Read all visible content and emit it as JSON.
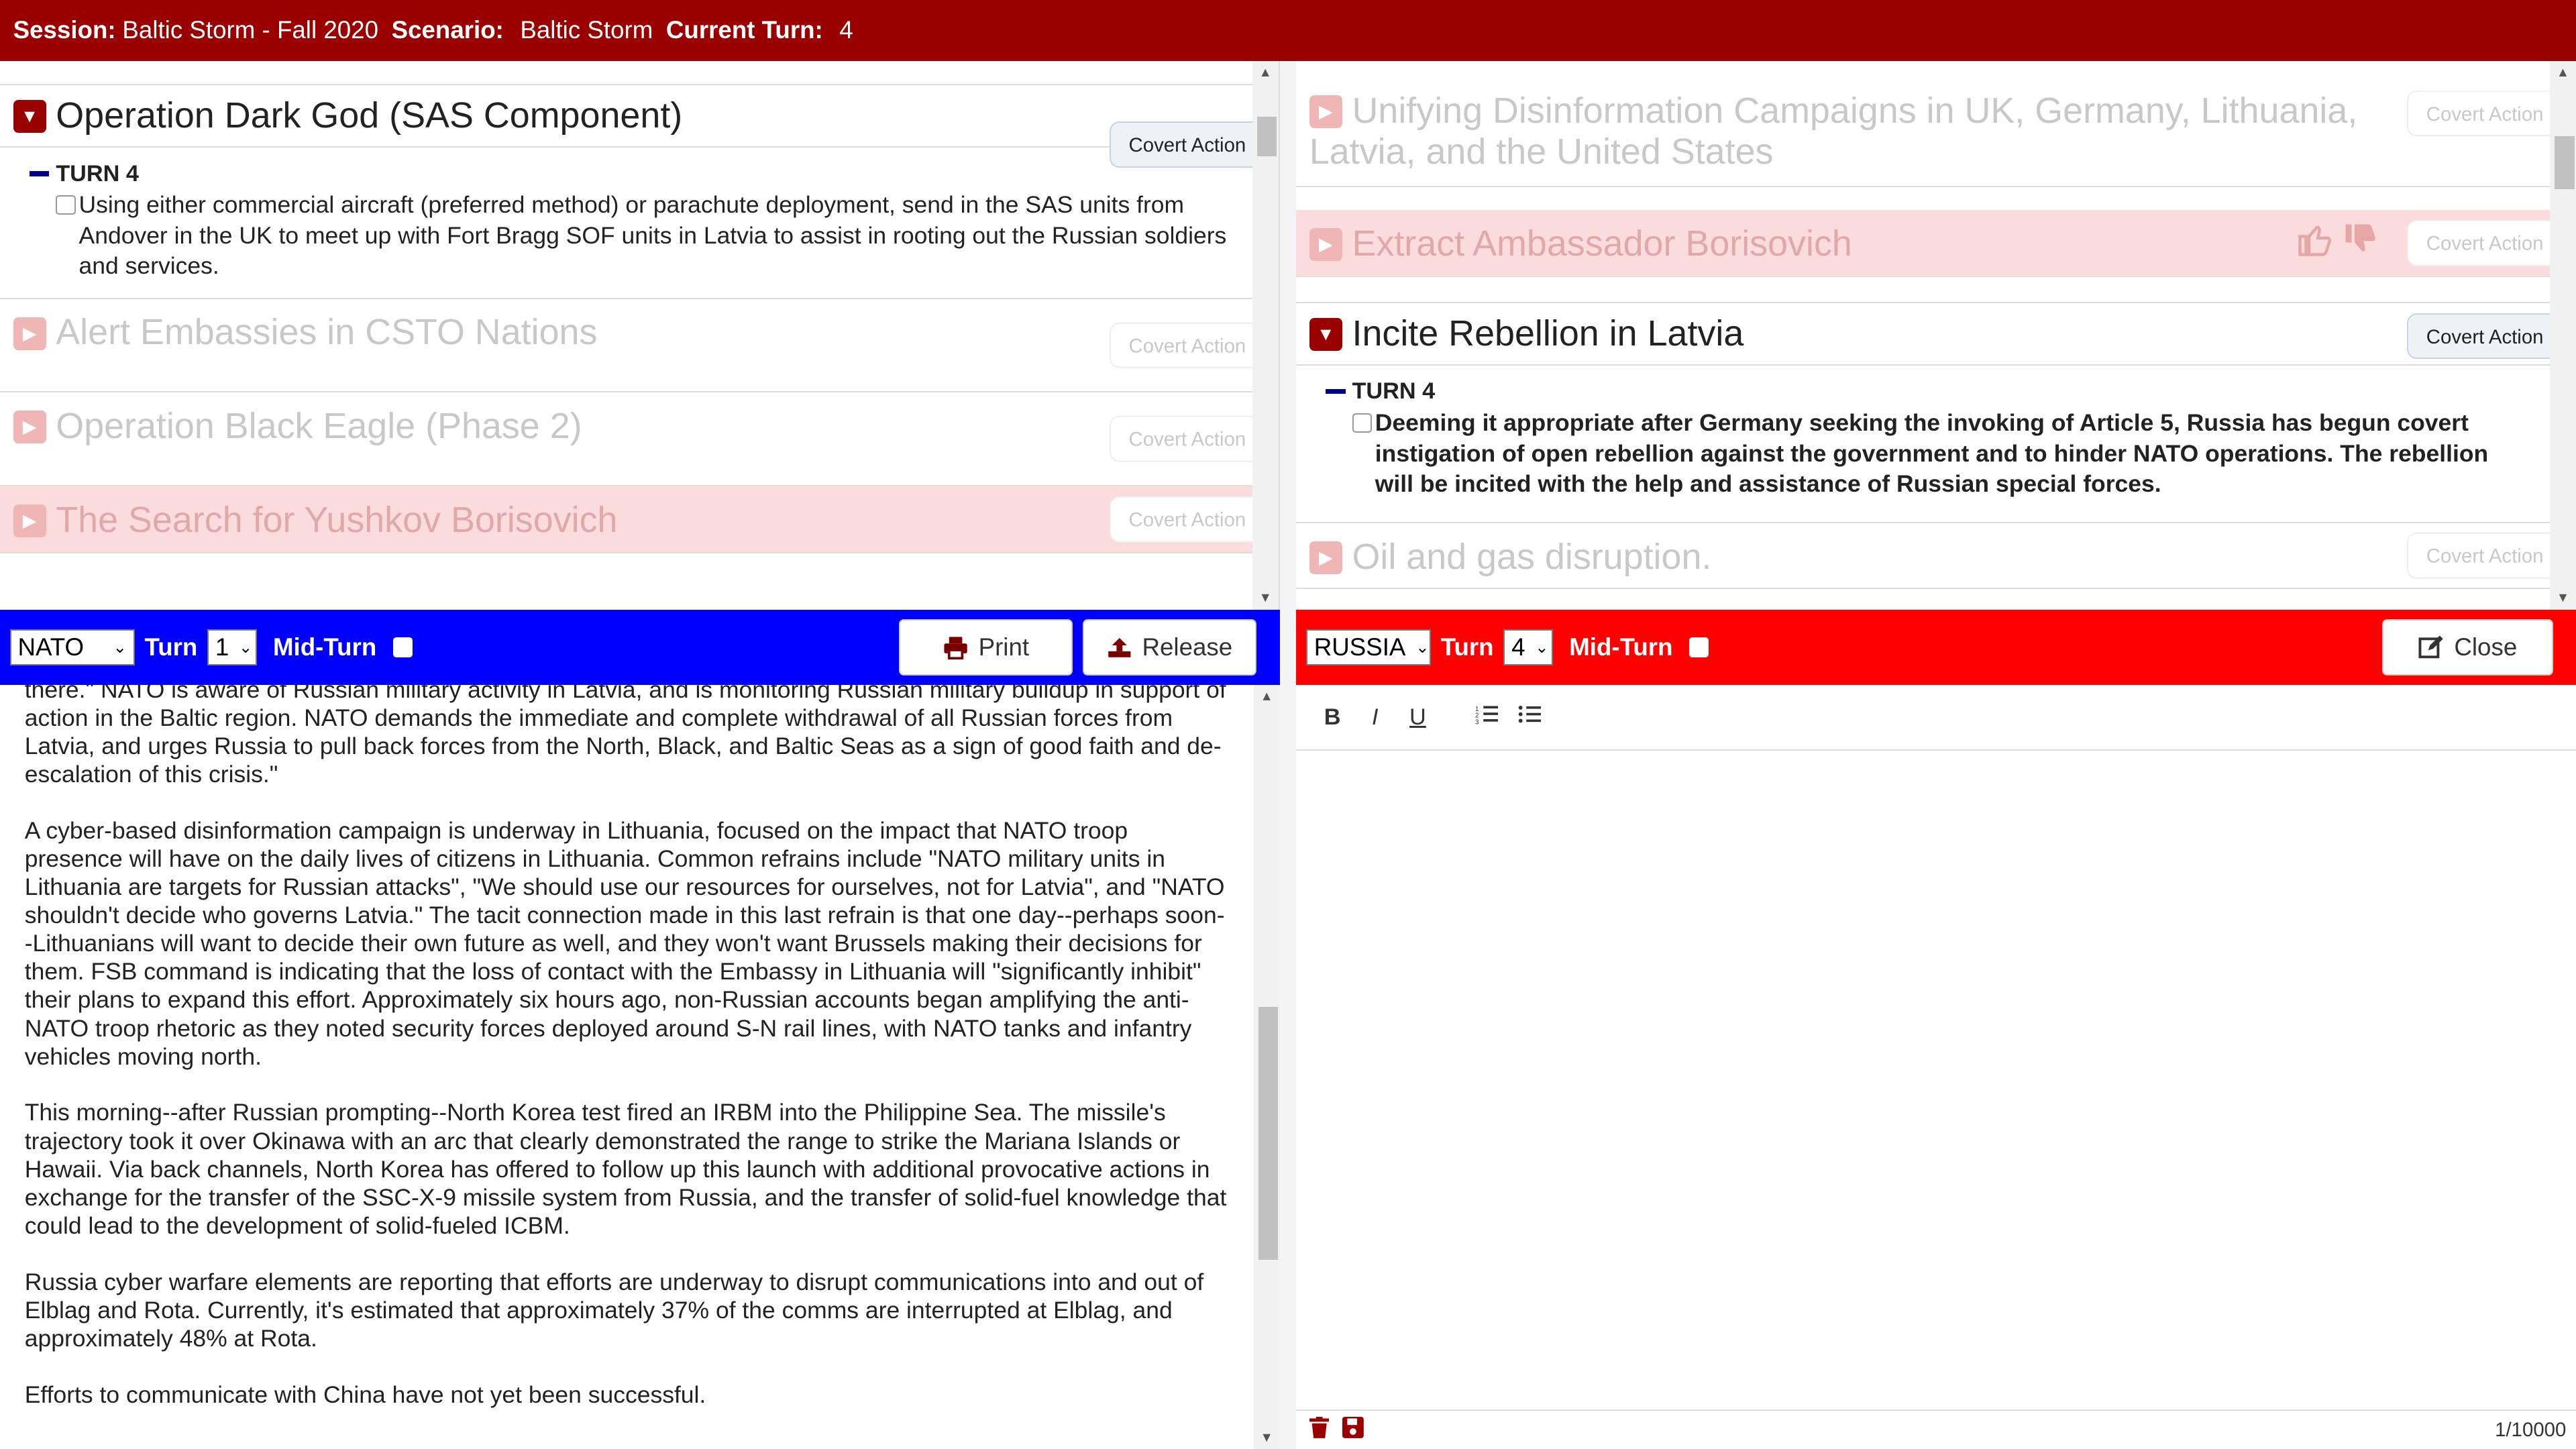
{
  "session": {
    "session_label": "Session:",
    "session_value": "Baltic Storm - Fall 2020",
    "scenario_label": "Scenario:",
    "scenario_value": "Baltic Storm",
    "turn_label": "Current Turn:",
    "turn_value": "4"
  },
  "left_actions": [
    {
      "title": "Operation Dark God (SAS Component)",
      "button": "Covert Action",
      "expanded": true,
      "turn": "TURN 4",
      "text": "Using either commercial aircraft (preferred method) or parachute deployment, send in the SAS units from Andover in the UK to meet up with Fort Bragg SOF units in Latvia to assist in rooting out the Russian soldiers and services."
    },
    {
      "title": "Alert Embassies in CSTO Nations",
      "button": "Covert Action"
    },
    {
      "title": "Operation Black Eagle (Phase 2)",
      "button": "Covert Action"
    },
    {
      "title": "The Search for Yushkov Borisovich",
      "button": "Covert Action"
    }
  ],
  "right_actions": [
    {
      "title": "Unifying Disinformation Campaigns in UK, Germany, Lithuania, Latvia, and the United States",
      "button": "Covert Action"
    },
    {
      "title": "Extract Ambassador Borisovich",
      "button": "Covert Action"
    },
    {
      "title": "Incite Rebellion in Latvia",
      "button": "Covert Action",
      "turn": "TURN 4",
      "text": "Deeming it appropriate after Germany seeking the invoking of Article 5, Russia has begun covert instigation of open rebellion against the government and to hinder NATO operations. The rebellion will be incited with the help and assistance of Russian special forces."
    },
    {
      "title": "Oil and gas disruption.",
      "button": "Covert Action"
    }
  ],
  "nato_toolbar": {
    "faction": "NATO",
    "turn_label": "Turn",
    "turn_value": "1",
    "midturn_label": "Mid-Turn",
    "print_label": "Print",
    "release_label": "Release"
  },
  "russia_toolbar": {
    "faction": "RUSSIA",
    "turn_label": "Turn",
    "turn_value": "4",
    "midturn_label": "Mid-Turn",
    "close_label": "Close"
  },
  "reading": {
    "p1": "there.\" NATO is aware of Russian military activity in Latvia, and is monitoring Russian military buildup in support of action in the Baltic region. NATO demands the immediate and complete withdrawal of all Russian forces from Latvia, and urges Russia to pull back forces from the North, Black, and Baltic Seas as a sign of good faith and de-escalation of this crisis.\"",
    "p2": "A cyber-based disinformation campaign is underway in Lithuania, focused on the impact that NATO troop presence will have on the daily lives of citizens in Lithuania. Common refrains include \"NATO military units in Lithuania are targets for Russian attacks\", \"We should use our resources for ourselves, not for Latvia\", and \"NATO shouldn't decide who governs Latvia.\" The tacit connection made in this last refrain is that one day--perhaps soon--Lithuanians will want to decide their own future as well, and they won't want Brussels making their decisions for them. FSB command is indicating that the loss of contact with the Embassy in Lithuania will \"significantly inhibit\" their plans to expand this effort. Approximately six hours ago, non-Russian accounts began amplifying the anti-NATO troop rhetoric as they noted security forces deployed around S-N rail lines, with NATO tanks and infantry vehicles moving north.",
    "p3": "This morning--after Russian prompting--North Korea test fired an IRBM into the Philippine Sea. The missile's trajectory took it over Okinawa with an arc that clearly demonstrated the range to strike the Mariana Islands or Hawaii. Via back channels, North Korea has offered to follow up this launch with additional provocative actions in exchange for the transfer of the SSC-X-9 missile system from Russia, and the transfer of solid-fuel knowledge that could lead to the development of solid-fueled ICBM.",
    "p4": "Russia cyber warfare elements are reporting that efforts are underway to disrupt communications into and out of Elblag and Rota. Currently, it's estimated that approximately 37% of the comms are interrupted at Elblag, and approximately 48% at Rota.",
    "p5": "Efforts to communicate with China have not yet been successful."
  },
  "editor": {
    "tools": [
      "B",
      "I",
      "U"
    ],
    "char_count": "1/10000"
  }
}
